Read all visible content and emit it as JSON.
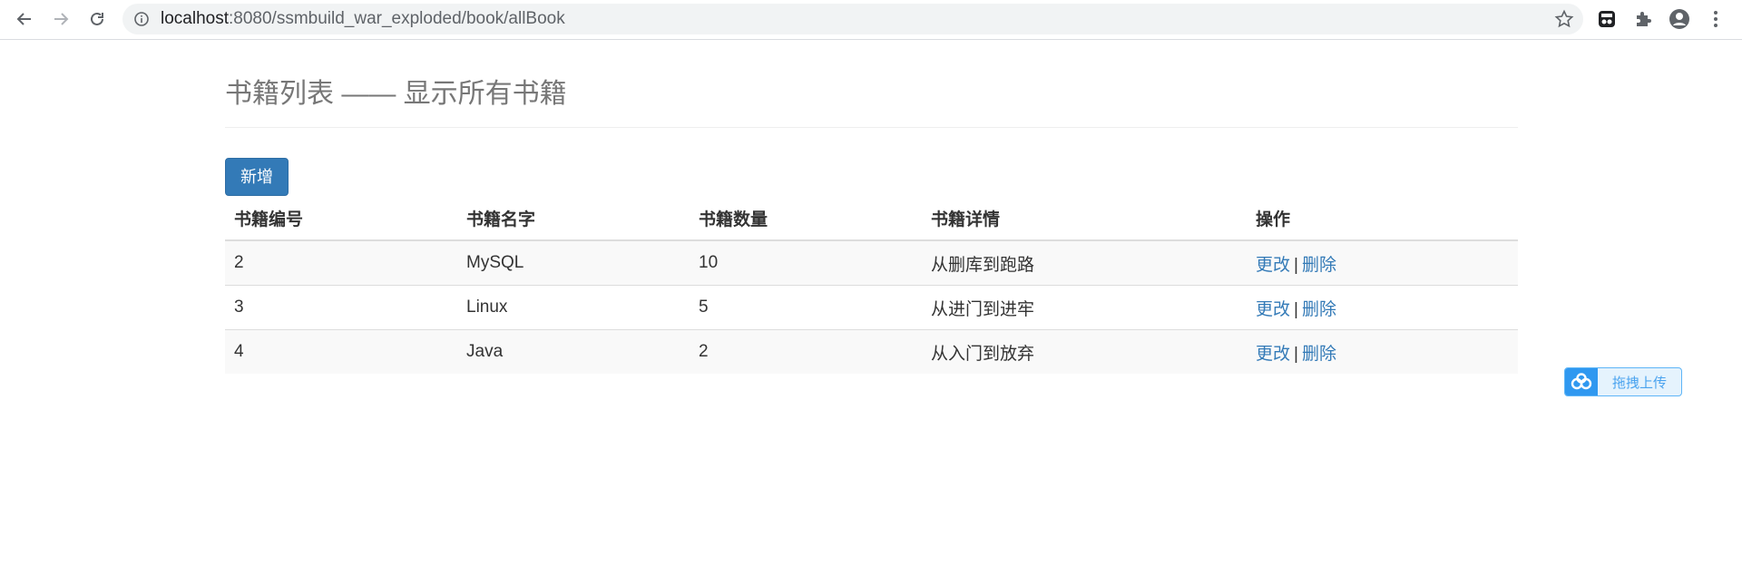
{
  "browser": {
    "url_host": "localhost",
    "url_path": ":8080/ssmbuild_war_exploded/book/allBook",
    "icons": [
      "back-arrow-icon",
      "forward-arrow-icon",
      "reload-icon",
      "info-icon",
      "bookmark-star-icon",
      "extension-app-icon",
      "puzzle-icon",
      "profile-icon",
      "kebab-menu-icon"
    ]
  },
  "page": {
    "title": "书籍列表 —— 显示所有书籍",
    "add_button_label": "新增"
  },
  "table": {
    "headers": [
      "书籍编号",
      "书籍名字",
      "书籍数量",
      "书籍详情",
      "操作"
    ],
    "rows": [
      {
        "id": "2",
        "name": "MySQL",
        "count": "10",
        "detail": "从删库到跑路"
      },
      {
        "id": "3",
        "name": "Linux",
        "count": "5",
        "detail": "从进门到进牢"
      },
      {
        "id": "4",
        "name": "Java",
        "count": "2",
        "detail": "从入门到放弃"
      }
    ],
    "edit_label": "更改",
    "separator": "|",
    "delete_label": "删除"
  },
  "upload_widget": {
    "label": "拖拽上传"
  },
  "colors": {
    "primary": "#337ab7",
    "title_gray": "#777777",
    "upload_blue": "#2f98f0"
  }
}
